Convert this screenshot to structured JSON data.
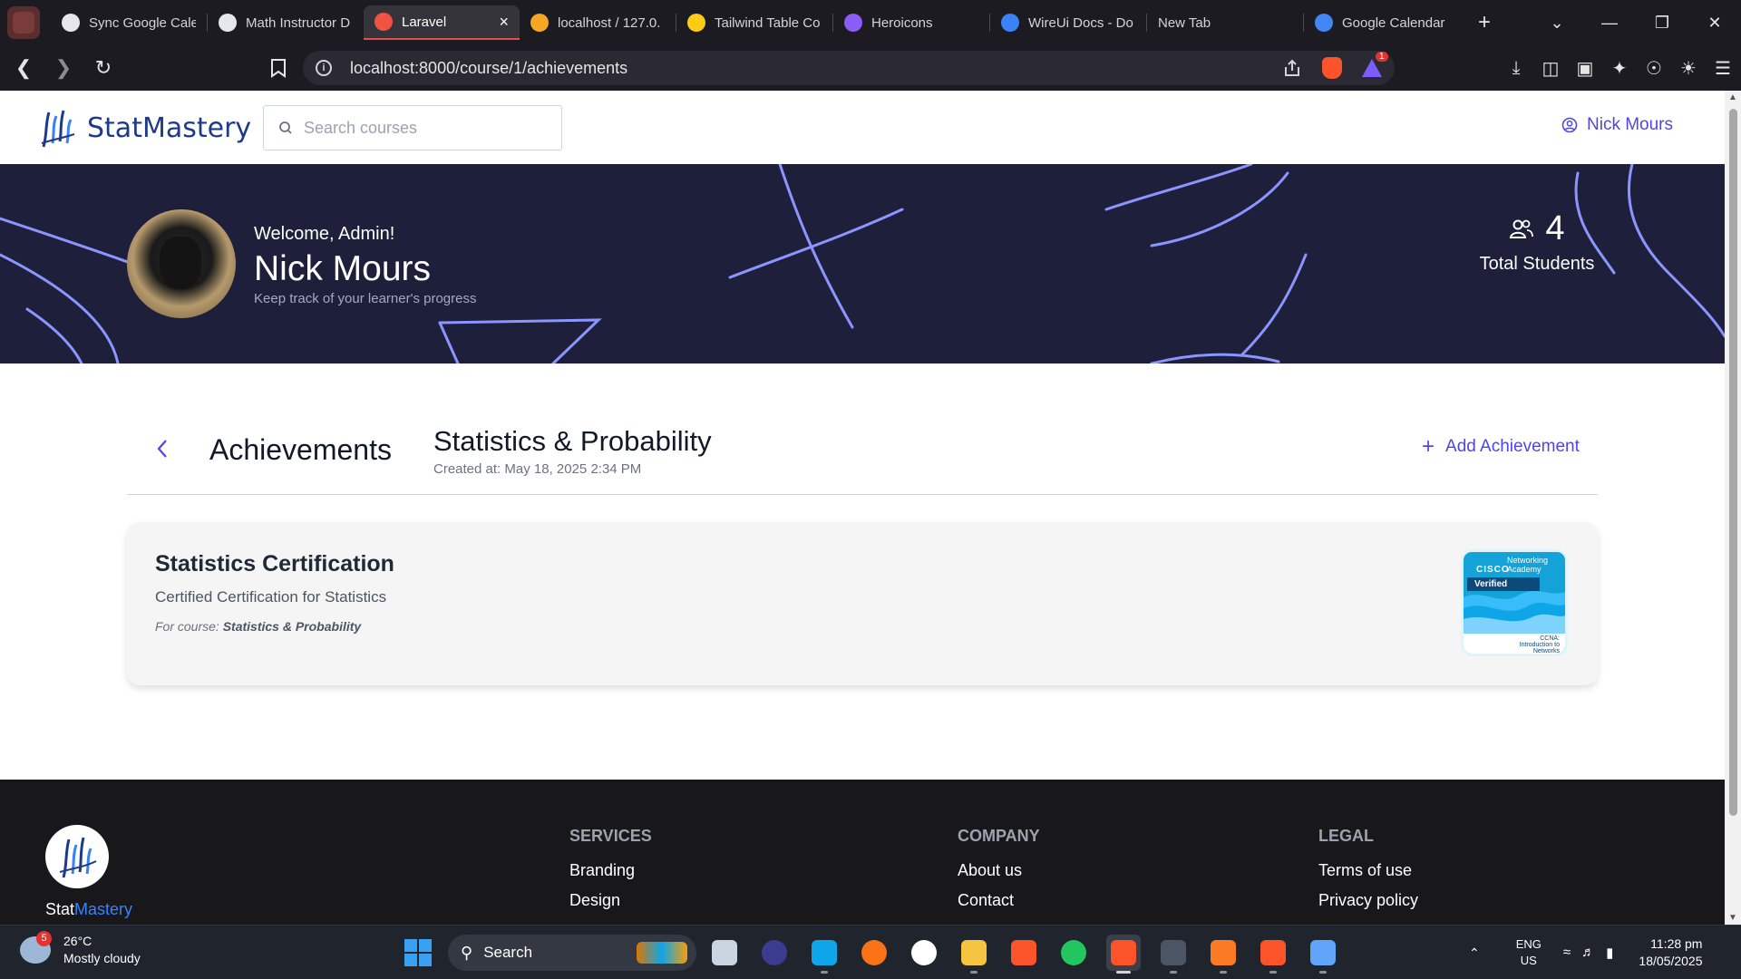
{
  "browser": {
    "tabs": [
      {
        "label": "Sync Google Cale",
        "icon": "openai-icon",
        "color": "#e5e7eb"
      },
      {
        "label": "Math Instructor D",
        "icon": "openai-icon",
        "color": "#e5e7eb"
      },
      {
        "label": "Laravel",
        "icon": "laravel-icon",
        "color": "#f05340",
        "active": true
      },
      {
        "label": "localhost / 127.0.",
        "icon": "phpmyadmin-icon",
        "color": "#f5a623"
      },
      {
        "label": "Tailwind Table Co",
        "icon": "emoji-icon",
        "color": "#facc15"
      },
      {
        "label": "Heroicons",
        "icon": "heroicons-shield-icon",
        "color": "#8b5cf6"
      },
      {
        "label": "WireUi Docs - Do",
        "icon": "globe-icon",
        "color": "#3b82f6"
      },
      {
        "label": "New Tab",
        "icon": "",
        "color": ""
      },
      {
        "label": "Google Calendar",
        "icon": "google-calendar-icon",
        "color": "#4285f4"
      }
    ],
    "url": "localhost:8000/course/1/achievements",
    "notification_count": "1"
  },
  "site": {
    "brand": "StatMastery",
    "search_placeholder": "Search courses",
    "user_name": "Nick Mours"
  },
  "hero": {
    "welcome": "Welcome, Admin!",
    "name": "Nick Mours",
    "subtitle": "Keep track of your learner's progress",
    "stat_value": "4",
    "stat_label": "Total Students"
  },
  "achievements": {
    "section_title": "Achievements",
    "course_title": "Statistics & Probability",
    "created_at": "Created at: May 18, 2025 2:34 PM",
    "add_label": "Add Achievement",
    "items": [
      {
        "title": "Statistics Certification",
        "description": "Certified Certification for Statistics",
        "course_prefix": "For course:",
        "course_name": "Statistics & Probability",
        "badge": {
          "org": "Networking Academy",
          "brand": "CISCO",
          "verified": "Verified",
          "course": "CCNA: Introduction to Networks"
        }
      }
    ]
  },
  "footer": {
    "brand_part1": "Stat",
    "brand_part2": "Mastery",
    "columns": [
      {
        "heading": "Services",
        "links": [
          "Branding",
          "Design"
        ]
      },
      {
        "heading": "Company",
        "links": [
          "About us",
          "Contact"
        ]
      },
      {
        "heading": "Legal",
        "links": [
          "Terms of use",
          "Privacy policy"
        ]
      }
    ]
  },
  "taskbar": {
    "weather_temp": "26°C",
    "weather_desc": "Mostly cloudy",
    "weather_badge": "5",
    "search_label": "Search",
    "lang_line1": "ENG",
    "lang_line2": "US",
    "time": "11:28 pm",
    "date": "18/05/2025",
    "apps": [
      {
        "name": "task-view-icon",
        "color": "#cbd5e1"
      },
      {
        "name": "eclipse-icon",
        "color": "#3b3b8f"
      },
      {
        "name": "vscode-icon",
        "color": "#0ea5e9"
      },
      {
        "name": "postman-icon",
        "color": "#f97316"
      },
      {
        "name": "mongodb-compass-icon",
        "color": "#ffffff"
      },
      {
        "name": "file-explorer-icon",
        "color": "#f5c542"
      },
      {
        "name": "brave-icon",
        "color": "#fb542b"
      },
      {
        "name": "chrome-icon",
        "color": "#22c55e"
      },
      {
        "name": "brave-active-icon",
        "color": "#fb542b"
      },
      {
        "name": "terminal-icon",
        "color": "#4b5563"
      },
      {
        "name": "xampp-icon",
        "color": "#fb7a24"
      },
      {
        "name": "brave-beta-icon",
        "color": "#fb542b"
      },
      {
        "name": "notepad-icon",
        "color": "#60a5fa"
      }
    ]
  }
}
